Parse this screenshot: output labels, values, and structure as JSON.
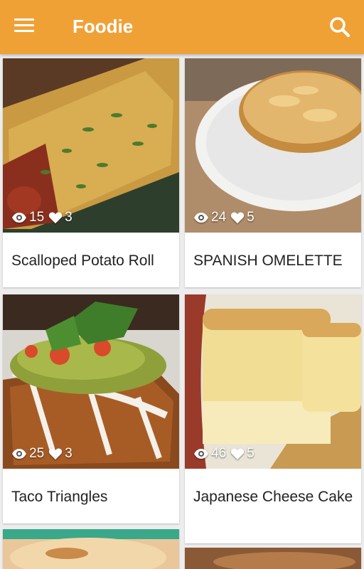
{
  "appbar": {
    "title": "Foodie",
    "bg_color": "#f0a136",
    "menu_icon": "hamburger-menu-icon",
    "search_icon": "search-icon"
  },
  "recipes": [
    {
      "title": "Scalloped Potato Roll",
      "views": "15",
      "likes": "3"
    },
    {
      "title": "SPANISH OMELETTE",
      "views": "24",
      "likes": "5"
    },
    {
      "title": "Taco Triangles",
      "views": "25",
      "likes": "3"
    },
    {
      "title": "Japanese Cheese Cake",
      "views": "46",
      "likes": "5"
    }
  ]
}
